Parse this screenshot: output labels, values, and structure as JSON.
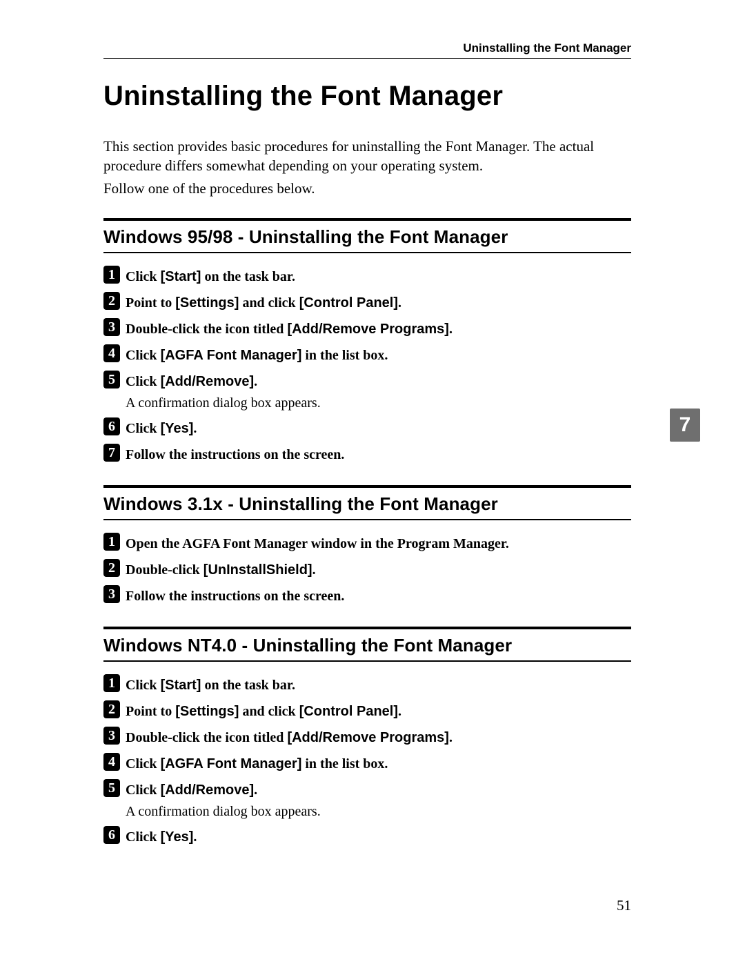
{
  "running_head": "Uninstalling the Font Manager",
  "title": "Uninstalling the Font Manager",
  "intro": "This section provides basic procedures for uninstalling the Font Manager. The actual procedure differs somewhat depending on your operating system.",
  "follow": "Follow one of the procedures below.",
  "chapter_tab": "7",
  "page_number": "51",
  "sections": {
    "win9598": {
      "heading": "Windows 95/98 - Uninstalling the Font Manager",
      "s1": {
        "a": "Click ",
        "b": "[Start]",
        "c": " on the task bar."
      },
      "s2": {
        "a": "Point to ",
        "b": "[Settings]",
        "c": " and click ",
        "d": "[Control Panel]",
        "e": "."
      },
      "s3": {
        "a": "Double-click the icon titled ",
        "b": "[Add/Remove Programs]",
        "c": "."
      },
      "s4": {
        "a": "Click ",
        "b": "[AGFA Font Manager]",
        "c": " in the list box."
      },
      "s5": {
        "a": "Click ",
        "b": "[Add/Remove]",
        "c": ".",
        "sub": "A confirmation dialog box appears."
      },
      "s6": {
        "a": "Click ",
        "b": "[Yes]",
        "c": "."
      },
      "s7": {
        "a": "Follow the instructions on the screen."
      }
    },
    "win31x": {
      "heading": "Windows 3.1x - Uninstalling the Font Manager",
      "s1": {
        "a": "Open the AGFA Font Manager window in the Program Manager."
      },
      "s2": {
        "a": "Double-click ",
        "b": "[UnInstallShield]",
        "c": "."
      },
      "s3": {
        "a": "Follow the instructions on the screen."
      }
    },
    "winnt40": {
      "heading": "Windows NT4.0 - Uninstalling the Font Manager",
      "s1": {
        "a": "Click ",
        "b": "[Start]",
        "c": " on the task bar."
      },
      "s2": {
        "a": "Point to ",
        "b": "[Settings]",
        "c": " and click ",
        "d": "[Control Panel]",
        "e": "."
      },
      "s3": {
        "a": "Double-click the icon titled ",
        "b": "[Add/Remove Programs]",
        "c": "."
      },
      "s4": {
        "a": "Click ",
        "b": "[AGFA Font Manager]",
        "c": " in the list box."
      },
      "s5": {
        "a": "Click ",
        "b": "[Add/Remove]",
        "c": ".",
        "sub": "A confirmation dialog box appears."
      },
      "s6": {
        "a": "Click ",
        "b": "[Yes]",
        "c": "."
      }
    }
  },
  "num": {
    "1": "1",
    "2": "2",
    "3": "3",
    "4": "4",
    "5": "5",
    "6": "6",
    "7": "7"
  }
}
